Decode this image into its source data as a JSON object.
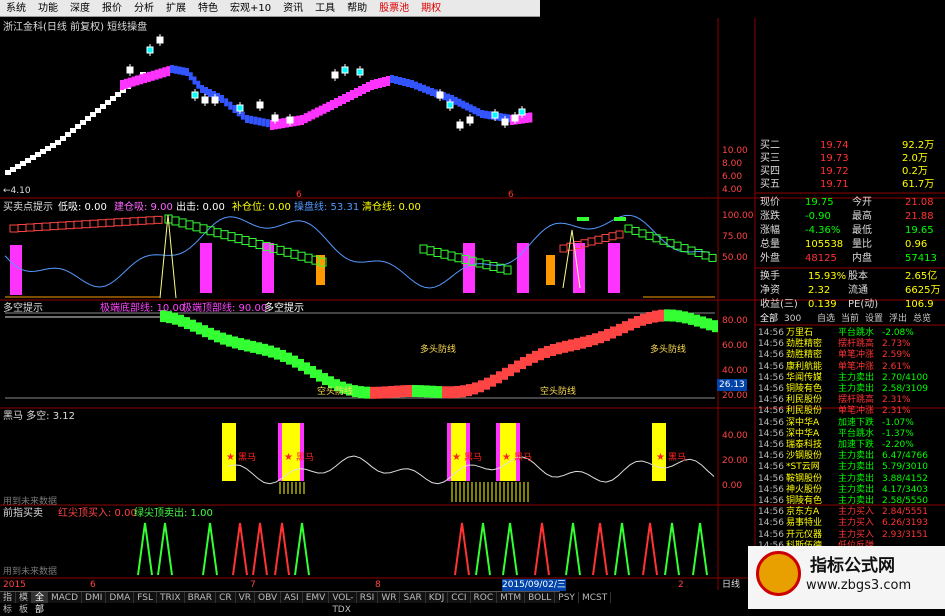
{
  "menu": {
    "items": [
      "系统",
      "功能",
      "深度",
      "报价",
      "分析",
      "扩展",
      "特色",
      "宏观+10",
      "资讯",
      "工具",
      "帮助",
      "股票池",
      "期权"
    ],
    "red_items": [
      "股票池",
      "期权"
    ]
  },
  "title": "浙江金科(日线 前复权) 短线操盘",
  "main_axis": {
    "ticks": [
      "10.00",
      "8.00",
      "6.00",
      "4.00"
    ],
    "low_label": "←4.10"
  },
  "panel1": {
    "name": "买卖点提示",
    "labels": [
      {
        "text": "低吸: 0.00",
        "color": "#ffffff"
      },
      {
        "text": "建仓吸: 9.00",
        "color": "#ff66ff"
      },
      {
        "text": "出击: 0.00",
        "color": "#ffffff"
      },
      {
        "text": "补仓位: 0.00",
        "color": "#ffff00"
      },
      {
        "text": "操盘线: 53.31",
        "color": "#5599ff"
      },
      {
        "text": "清仓线: 0.00",
        "color": "#ffff00"
      }
    ],
    "ticks": [
      "100.00",
      "75.00",
      "50.00"
    ]
  },
  "panel2": {
    "name": "多空提示",
    "labels": [
      {
        "text": "极端底部线: 10.00",
        "color": "#ff44ff"
      },
      {
        "text": "极端顶部线: 90.00",
        "color": "#ff44ff"
      },
      {
        "text": "多空提示",
        "color": "#ffffff"
      }
    ],
    "annotations": [
      "空头防线",
      "多头防线",
      "空头防线",
      "多头防线",
      "空头防线"
    ],
    "ticks": [
      "80.00",
      "60.00",
      "40.00",
      "20.00"
    ],
    "current": "26.13"
  },
  "panel3": {
    "name": "黑马 多空: 3.12",
    "horse_label": "黑马",
    "ticks": [
      "40.00",
      "20.00",
      "0.00"
    ],
    "note": "用到未来数据"
  },
  "panel4": {
    "name": "前指买卖",
    "labels": [
      {
        "text": "红尖顶买入: 0.00",
        "color": "#ff4444"
      },
      {
        "text": "绿尖顶卖出: 1.00",
        "color": "#44ff44"
      }
    ],
    "note": "用到未来数据"
  },
  "date_axis": {
    "start": "2015",
    "months": [
      "6",
      "7",
      "8",
      "9",
      "2"
    ],
    "cursor": "2015/09/02/三",
    "end": "日线"
  },
  "quotes": {
    "bids": [
      {
        "label": "买二",
        "price": "19.74",
        "vol": "92.2万"
      },
      {
        "label": "买三",
        "price": "19.73",
        "vol": "2.0万"
      },
      {
        "label": "买四",
        "price": "19.72",
        "vol": "0.2万"
      },
      {
        "label": "买五",
        "price": "19.71",
        "vol": "61.7万"
      }
    ],
    "stats": [
      {
        "l1": "现价",
        "v1": "19.75",
        "l2": "今开",
        "v2": "21.08",
        "c1": "#00ff00",
        "c2": "#ff3333"
      },
      {
        "l1": "涨跌",
        "v1": "-0.90",
        "l2": "最高",
        "v2": "21.88",
        "c1": "#00ff00",
        "c2": "#ff3333"
      },
      {
        "l1": "涨幅",
        "v1": "-4.36%",
        "l2": "最低",
        "v2": "19.65",
        "c1": "#00ff00",
        "c2": "#00ff00"
      },
      {
        "l1": "总量",
        "v1": "105538",
        "l2": "量比",
        "v2": "0.96",
        "c1": "#ffff00",
        "c2": "#ffff00"
      },
      {
        "l1": "外盘",
        "v1": "48125",
        "l2": "内盘",
        "v2": "57413",
        "c1": "#ff3333",
        "c2": "#00ff00"
      }
    ],
    "stats2": [
      {
        "l1": "换手",
        "v1": "15.93%",
        "l2": "股本",
        "v2": "2.65亿"
      },
      {
        "l1": "净资",
        "v1": "2.32",
        "l2": "流通",
        "v2": "6625万"
      },
      {
        "l1": "收益(三)",
        "v1": "0.139",
        "l2": "PE(动)",
        "v2": "106.9"
      }
    ]
  },
  "tabs": [
    "全部",
    "300",
    "自选",
    "当前",
    "设置",
    "浮出",
    "总览"
  ],
  "ticks": [
    {
      "time": "14:56",
      "name": "万里石",
      "type": "平台跳水",
      "pct": "-2.08%",
      "c": "#00ff00"
    },
    {
      "time": "14:56",
      "name": "劲胜精密",
      "type": "摆杆跳高",
      "pct": "2.73%",
      "c": "#ff3333"
    },
    {
      "time": "14:56",
      "name": "劲胜精密",
      "type": "单笔冲涨",
      "pct": "2.59%",
      "c": "#ff3333"
    },
    {
      "time": "14:56",
      "name": "康利航能",
      "type": "单笔冲涨",
      "pct": "2.61%",
      "c": "#ff3333"
    },
    {
      "time": "14:56",
      "name": "华闻传媒",
      "type": "主力卖出",
      "pct": "2.70/4100",
      "c": "#00ff00"
    },
    {
      "time": "14:56",
      "name": "铜陵有色",
      "type": "主力卖出",
      "pct": "2.58/3109",
      "c": "#00ff00"
    },
    {
      "time": "14:56",
      "name": "利民股份",
      "type": "摆杆跳高",
      "pct": "2.31%",
      "c": "#ff3333"
    },
    {
      "time": "14:56",
      "name": "利民股份",
      "type": "单笔冲涨",
      "pct": "2.31%",
      "c": "#ff3333"
    },
    {
      "time": "14:56",
      "name": "深中华A",
      "type": "加速下跌",
      "pct": "-1.07%",
      "c": "#00ff00"
    },
    {
      "time": "14:56",
      "name": "深中华A",
      "type": "平台跳水",
      "pct": "-1.37%",
      "c": "#00ff00"
    },
    {
      "time": "14:56",
      "name": "瑞泰科技",
      "type": "加速下跌",
      "pct": "-2.20%",
      "c": "#00ff00"
    },
    {
      "time": "14:56",
      "name": "沙钢股份",
      "type": "主力卖出",
      "pct": "6.47/4766",
      "c": "#00ff00"
    },
    {
      "time": "14:56",
      "name": "*ST云网",
      "type": "主力卖出",
      "pct": "5.79/3010",
      "c": "#00ff00"
    },
    {
      "time": "14:56",
      "name": "鞍钢股份",
      "type": "主力卖出",
      "pct": "3.88/4152",
      "c": "#00ff00"
    },
    {
      "time": "14:56",
      "name": "神火股份",
      "type": "主力卖出",
      "pct": "4.17/3403",
      "c": "#00ff00"
    },
    {
      "time": "14:56",
      "name": "铜陵有色",
      "type": "主力卖出",
      "pct": "2.58/5550",
      "c": "#00ff00"
    },
    {
      "time": "14:56",
      "name": "京东方A",
      "type": "主力买入",
      "pct": "2.84/5551",
      "c": "#ff3333"
    },
    {
      "time": "14:56",
      "name": "易事特业",
      "type": "主力买入",
      "pct": "6.26/3193",
      "c": "#ff3333"
    },
    {
      "time": "14:56",
      "name": "开元仪器",
      "type": "主力买入",
      "pct": "2.93/3151",
      "c": "#ff3333"
    },
    {
      "time": "14:56",
      "name": "科斯伍德",
      "type": "低位反弹",
      "pct": "",
      "c": "#ff3333"
    }
  ],
  "bottom_tabs": [
    "指标",
    "模板",
    "全部",
    "MACD",
    "DMI",
    "DMA",
    "FSL",
    "TRIX",
    "BRAR",
    "CR",
    "VR",
    "OBV",
    "ASI",
    "EMV",
    "VOL-TDX",
    "RSI",
    "WR",
    "SAR",
    "KDJ",
    "CCI",
    "ROC",
    "MTM",
    "BOLL",
    "PSY",
    "MCST"
  ],
  "watermark": {
    "line1": "指标公式网",
    "line2": "www.zbgs3.com"
  }
}
